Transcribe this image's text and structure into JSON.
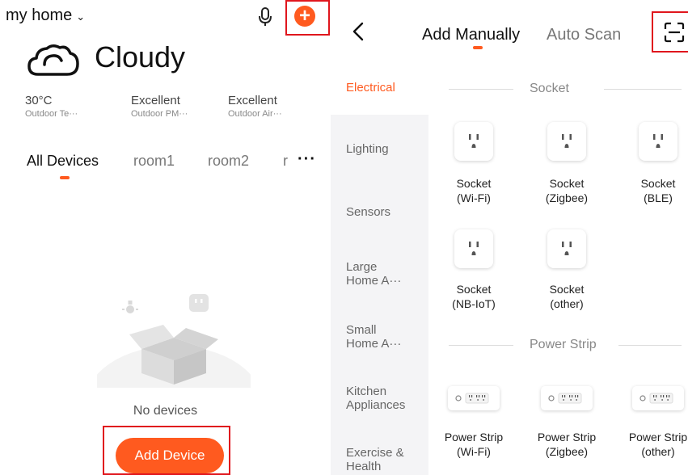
{
  "left": {
    "home_name": "my home",
    "weather": {
      "condition": "Cloudy"
    },
    "metrics": [
      {
        "value": "30°C",
        "label": "Outdoor Te···"
      },
      {
        "value": "Excellent",
        "label": "Outdoor PM···"
      },
      {
        "value": "Excellent",
        "label": "Outdoor Air···"
      }
    ],
    "tabs": [
      "All Devices",
      "room1",
      "room2",
      "r"
    ],
    "more_label": "···",
    "empty_text": "No devices",
    "add_device_label": "Add Device"
  },
  "right": {
    "header": {
      "tab_manual": "Add Manually",
      "tab_auto": "Auto Scan"
    },
    "categories": [
      {
        "label": "Electrical",
        "active": true
      },
      {
        "label": "Lighting"
      },
      {
        "label": "Sensors"
      },
      {
        "label": "Large\nHome A···"
      },
      {
        "label": "Small\nHome A···"
      },
      {
        "label": "Kitchen\nAppliances"
      },
      {
        "label": "Exercise &\nHealth"
      }
    ],
    "sections": [
      {
        "title": "Socket",
        "items": [
          {
            "line1": "Socket",
            "line2": "(Wi-Fi)"
          },
          {
            "line1": "Socket",
            "line2": "(Zigbee)"
          },
          {
            "line1": "Socket",
            "line2": "(BLE)"
          },
          {
            "line1": "Socket",
            "line2": "(NB-IoT)"
          },
          {
            "line1": "Socket",
            "line2": "(other)"
          }
        ]
      },
      {
        "title": "Power Strip",
        "items": [
          {
            "line1": "Power Strip",
            "line2": "(Wi-Fi)"
          },
          {
            "line1": "Power Strip",
            "line2": "(Zigbee)"
          },
          {
            "line1": "Power Strip",
            "line2": "(other)"
          }
        ]
      }
    ]
  },
  "colors": {
    "accent": "#ff5a1f",
    "highlight": "#e0161d"
  }
}
